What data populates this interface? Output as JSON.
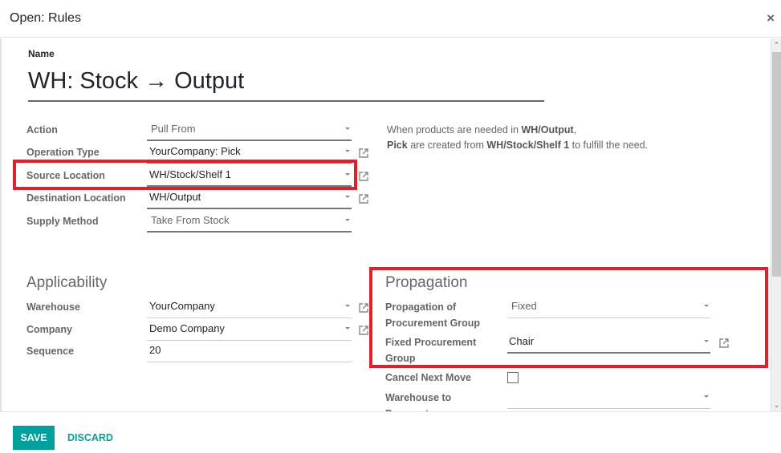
{
  "dialog": {
    "title": "Open: Rules",
    "close_icon": "×"
  },
  "form": {
    "name_label": "Name",
    "name_value": "WH: Stock → Output",
    "main_fields": [
      {
        "label": "Action",
        "value": "Pull From"
      },
      {
        "label": "Operation Type",
        "value": "YourCompany: Pick"
      },
      {
        "label": "Source Location",
        "value": "WH/Stock/Shelf 1"
      },
      {
        "label": "Destination Location",
        "value": "WH/Output"
      },
      {
        "label": "Supply Method",
        "value": "Take From Stock"
      }
    ],
    "help": {
      "line1_prefix": "When products are needed in ",
      "line1_bold": "WH/Output",
      "line1_suffix": ",",
      "line2_bold1": "Pick",
      "line2_mid": " are created from ",
      "line2_bold2": "WH/Stock/Shelf 1",
      "line2_suffix": " to fulfill the need."
    },
    "applicability": {
      "title": "Applicability",
      "fields": [
        {
          "label": "Warehouse",
          "value": "YourCompany"
        },
        {
          "label": "Company",
          "value": "Demo Company"
        },
        {
          "label": "Sequence",
          "value": "20"
        }
      ]
    },
    "propagation": {
      "title": "Propagation",
      "fields": [
        {
          "label": "Propagation of Procurement Group",
          "value": "Fixed"
        },
        {
          "label": "Fixed Procurement Group",
          "value": "Chair"
        },
        {
          "label": "Cancel Next Move",
          "checked": false
        },
        {
          "label": "Warehouse to Propagate",
          "value": ""
        }
      ]
    }
  },
  "footer": {
    "save_label": "SAVE",
    "discard_label": "DISCARD"
  },
  "colors": {
    "primary": "#00a09d",
    "highlight": "#e41e2b"
  }
}
